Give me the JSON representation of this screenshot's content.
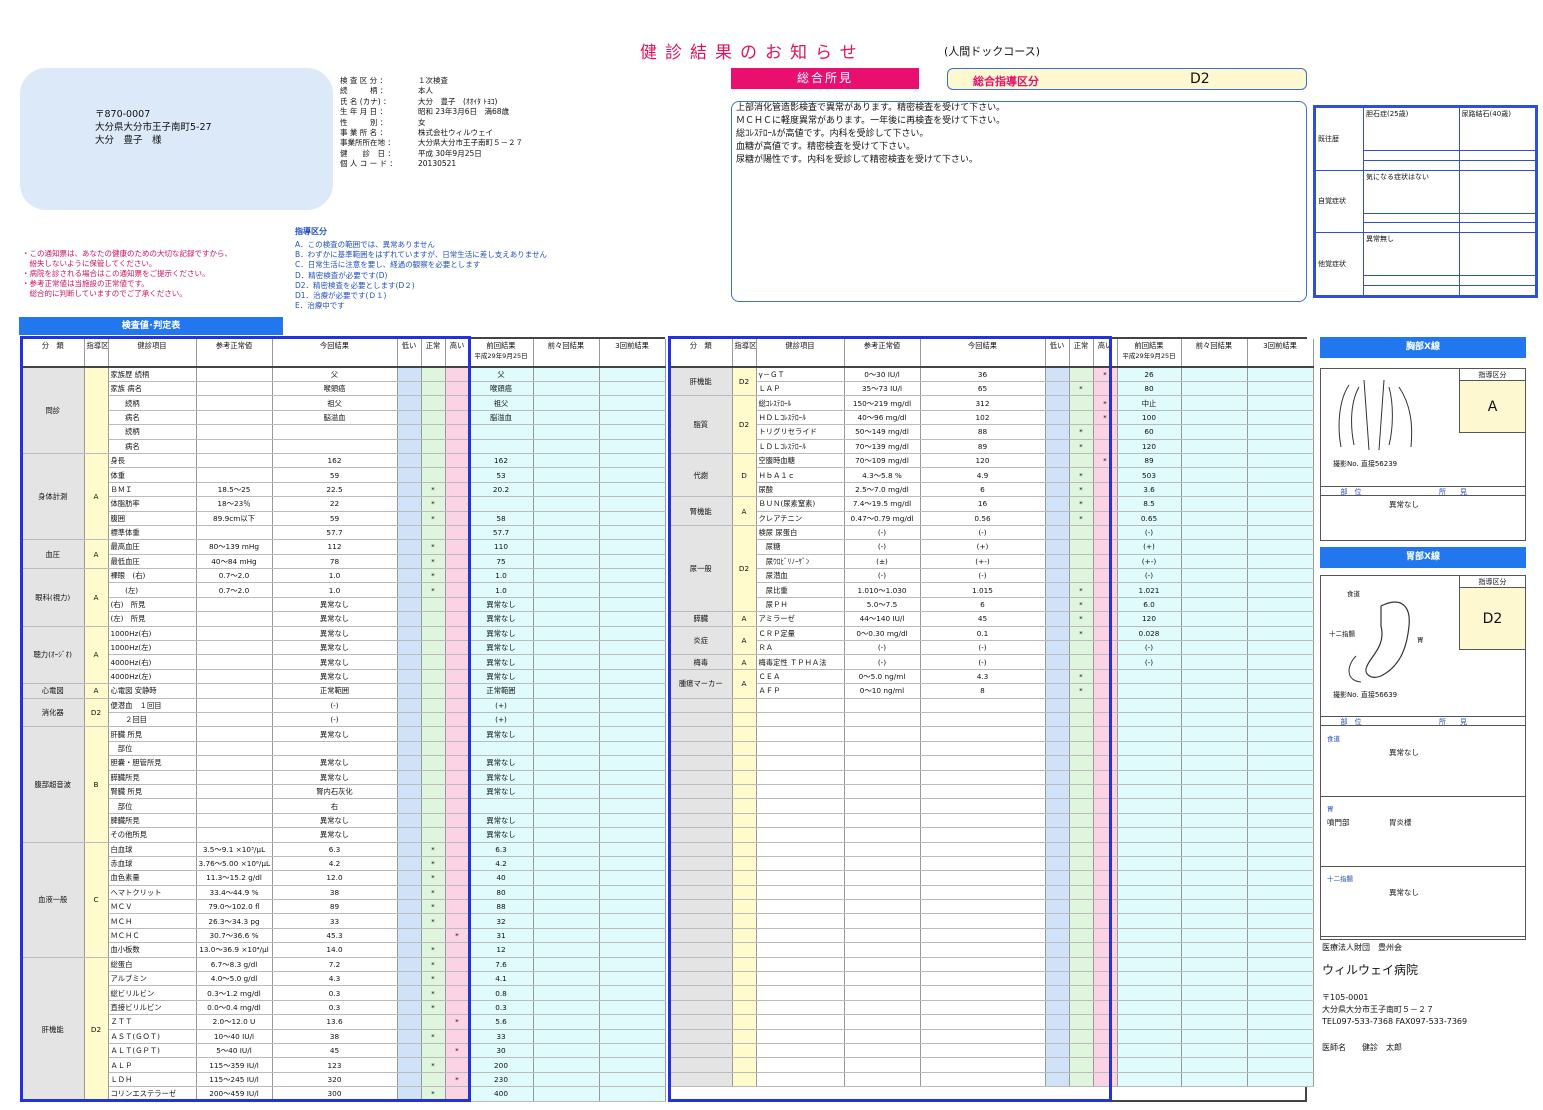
{
  "header": {
    "title": "健診結果のお知らせ",
    "subtitle": "(人間ドックコース)"
  },
  "address": {
    "zip": "〒870-0007",
    "line": "大分県大分市王子南町5-27",
    "name": "大分　豊子　様"
  },
  "patient": [
    {
      "k": "検 査 区 分 ：",
      "v": "１次検査"
    },
    {
      "k": "続　　　柄 ：",
      "v": "本人"
    },
    {
      "k": "氏 名 (カナ) ：",
      "v": "大分　豊子　(ｵｵｲﾀ ﾄﾖｺ)"
    },
    {
      "k": "生 年 月 日 ：",
      "v": "昭和 23年3月6日　満68歳"
    },
    {
      "k": "性　　　別 ：",
      "v": "女"
    },
    {
      "k": "事 業 所 名 ：",
      "v": "株式会社ウィルウェイ"
    },
    {
      "k": "事業所所在地 ：",
      "v": "大分県大分市王子南町５－２７"
    },
    {
      "k": "健　　診　日 ：",
      "v": "平成 30年9月25日"
    },
    {
      "k": "個 人 コ ー ド ：",
      "v": "20130521"
    }
  ],
  "notes": [
    "・この通知票は、あなたの健康のための大切な記録ですから、",
    "　紛失しないように保管してください。",
    "・病院を診される場合はこの通知票をご提示ください。",
    "・参考正常値は当施設の正常値です。",
    "　総合的に判断していますのでご了承ください。"
  ],
  "guide": {
    "title": "指導区分",
    "items": [
      "A．この検査の範囲では、異常ありません",
      "B．わずかに基準範囲をはずれていますが、日常生活に差し支えありません",
      "C．日常生活に注意を要し、経過の観察を必要とします",
      "D．精密検査が必要です(D)",
      "D2．精密検査を必要とします(D２)",
      "D1．治療が必要です(Ｄ１)",
      "E．治療中です"
    ]
  },
  "summary": {
    "label": "総合所見",
    "guide_label": "総合指導区分",
    "guide_value": "D2",
    "findings": [
      "上部消化管造影検査で異常があります。精密検査を受けて下さい。",
      "ＭＣＨＣに軽度異常があります。一年後に再検査を受けて下さい。",
      "総ｺﾚｽﾃﾛｰﾙが高値です。内科を受診して下さい。",
      "血糖が高値です。精密検査を受けて下さい。",
      "尿糖が陽性です。内科を受診して精密検査を受けて下さい。"
    ]
  },
  "history": [
    {
      "label": "既往歴",
      "rows": [
        [
          "胆石症(25歳)",
          "尿路結石(40歳)"
        ],
        [
          "",
          ""
        ],
        [
          "",
          ""
        ]
      ]
    },
    {
      "label": "自覚症状",
      "rows": [
        [
          "気になる症状はない",
          ""
        ],
        [
          "",
          ""
        ],
        [
          "",
          ""
        ]
      ]
    },
    {
      "label": "他覚症状",
      "rows": [
        [
          "異常無し",
          ""
        ],
        [
          "",
          ""
        ],
        [
          "",
          ""
        ]
      ]
    }
  ],
  "section_title": "検査値･判定表",
  "table_headers": [
    "分　類",
    "指導区分",
    "健診項目",
    "参考正常値",
    "今回結果",
    "低い",
    "正常",
    "高い",
    "前回結果",
    "前々回結果",
    "3回前結果"
  ],
  "prev_date": "平成29年9月25日",
  "left_rows": [
    [
      "問診",
      "",
      "家族歴 続柄",
      "",
      "父",
      "",
      "",
      "",
      "父",
      "",
      ""
    ],
    [
      "",
      "",
      "家族 病名",
      "",
      "喉頭癌",
      "",
      "",
      "",
      "喉頭癌",
      "",
      ""
    ],
    [
      "",
      "",
      "　　続柄",
      "",
      "祖父",
      "",
      "",
      "",
      "祖父",
      "",
      ""
    ],
    [
      "",
      "",
      "　　病名",
      "",
      "脳溢血",
      "",
      "",
      "",
      "脳溢血",
      "",
      ""
    ],
    [
      "",
      "",
      "　　続柄",
      "",
      "",
      "",
      "",
      "",
      "",
      "",
      ""
    ],
    [
      "",
      "",
      "　　病名",
      "",
      "",
      "",
      "",
      "",
      "",
      "",
      ""
    ],
    [
      "身体計測",
      "A",
      "身長",
      "",
      "162",
      "",
      "",
      "",
      "162",
      "",
      ""
    ],
    [
      "",
      "",
      "体重",
      "",
      "59",
      "",
      "",
      "",
      "53",
      "",
      ""
    ],
    [
      "",
      "",
      "ＢＭＩ",
      "18.5～25",
      "22.5",
      "",
      "*",
      "",
      "20.2",
      "",
      ""
    ],
    [
      "",
      "",
      "体脂肪率",
      "18～23％",
      "22",
      "",
      "*",
      "",
      "",
      "",
      ""
    ],
    [
      "",
      "",
      "腹囲",
      "89.9cm以下",
      "59",
      "",
      "*",
      "",
      "58",
      "",
      ""
    ],
    [
      "",
      "",
      "標準体重",
      "",
      "57.7",
      "",
      "",
      "",
      "57.7",
      "",
      ""
    ],
    [
      "血圧",
      "A",
      "最高血圧",
      "80～139 mHg",
      "112",
      "",
      "*",
      "",
      "110",
      "",
      ""
    ],
    [
      "",
      "",
      "最低血圧",
      "40～84 mHg",
      "78",
      "",
      "*",
      "",
      "75",
      "",
      ""
    ],
    [
      "眼科(視力)",
      "A",
      "裸眼　(右)",
      "0.7～2.0",
      "1.0",
      "",
      "*",
      "",
      "1.0",
      "",
      ""
    ],
    [
      "",
      "",
      "　　(左)",
      "0.7～2.0",
      "1.0",
      "",
      "*",
      "",
      "1.0",
      "",
      ""
    ],
    [
      "",
      "",
      "(右)　所見",
      "",
      "異常なし",
      "",
      "",
      "",
      "異常なし",
      "",
      ""
    ],
    [
      "",
      "",
      "(左)　所見",
      "",
      "異常なし",
      "",
      "",
      "",
      "異常なし",
      "",
      ""
    ],
    [
      "聴力(ｵｰｼﾞｵ)",
      "A",
      "1000Hz(右)",
      "",
      "異常なし",
      "",
      "",
      "",
      "異常なし",
      "",
      ""
    ],
    [
      "",
      "",
      "1000Hz(左)",
      "",
      "異常なし",
      "",
      "",
      "",
      "異常なし",
      "",
      ""
    ],
    [
      "",
      "",
      "4000Hz(右)",
      "",
      "異常なし",
      "",
      "",
      "",
      "異常なし",
      "",
      ""
    ],
    [
      "",
      "",
      "4000Hz(左)",
      "",
      "異常なし",
      "",
      "",
      "",
      "異常なし",
      "",
      ""
    ],
    [
      "心電図",
      "A",
      "心電図 安静時",
      "",
      "正常範囲",
      "",
      "",
      "",
      "正常範囲",
      "",
      ""
    ],
    [
      "消化器",
      "D2",
      "便潜血　１回目",
      "",
      "(-)",
      "",
      "",
      "",
      "(+)",
      "",
      ""
    ],
    [
      "",
      "",
      "　　２回目",
      "",
      "(-)",
      "",
      "",
      "",
      "(+)",
      "",
      ""
    ],
    [
      "腹部超音波",
      "B",
      "肝臓 所見",
      "",
      "異常なし",
      "",
      "",
      "",
      "異常なし",
      "",
      ""
    ],
    [
      "",
      "",
      "　部位",
      "",
      "",
      "",
      "",
      "",
      "",
      "",
      ""
    ],
    [
      "",
      "",
      "胆嚢・胆管所見",
      "",
      "異常なし",
      "",
      "",
      "",
      "異常なし",
      "",
      ""
    ],
    [
      "",
      "",
      "膵臓所見",
      "",
      "異常なし",
      "",
      "",
      "",
      "異常なし",
      "",
      ""
    ],
    [
      "",
      "",
      "腎臓 所見",
      "",
      "腎内石灰化",
      "",
      "",
      "",
      "異常なし",
      "",
      ""
    ],
    [
      "",
      "",
      "　部位",
      "",
      "右",
      "",
      "",
      "",
      "",
      "",
      ""
    ],
    [
      "",
      "",
      "脾臓所見",
      "",
      "異常なし",
      "",
      "",
      "",
      "異常なし",
      "",
      ""
    ],
    [
      "",
      "",
      "その他所見",
      "",
      "異常なし",
      "",
      "",
      "",
      "異常なし",
      "",
      ""
    ],
    [
      "血液一般",
      "C",
      "白血球",
      "3.5～9.1 ×10³/μL",
      "6.3",
      "",
      "*",
      "",
      "6.3",
      "",
      ""
    ],
    [
      "",
      "",
      "赤血球",
      "3.76～5.00 ×10⁶/μL",
      "4.2",
      "",
      "*",
      "",
      "4.2",
      "",
      ""
    ],
    [
      "",
      "",
      "血色素量",
      "11.3～15.2 g/dl",
      "12.0",
      "",
      "*",
      "",
      "40",
      "",
      ""
    ],
    [
      "",
      "",
      "ヘマトクリット",
      "33.4～44.9 %",
      "38",
      "",
      "*",
      "",
      "80",
      "",
      ""
    ],
    [
      "",
      "",
      "ＭＣＶ",
      "79.0～102.0 fl",
      "89",
      "",
      "*",
      "",
      "88",
      "",
      ""
    ],
    [
      "",
      "",
      "ＭＣＨ",
      "26.3～34.3 pg",
      "33",
      "",
      "*",
      "",
      "32",
      "",
      ""
    ],
    [
      "",
      "",
      "ＭＣＨＣ",
      "30.7～36.6 %",
      "45.3",
      "",
      "",
      "*",
      "31",
      "",
      ""
    ],
    [
      "",
      "",
      "血小板数",
      "13.0～36.9 ×10⁴/μl",
      "14.0",
      "",
      "*",
      "",
      "12",
      "",
      ""
    ],
    [
      "肝機能",
      "D2",
      "総蛋白",
      "6.7～8.3 g/dl",
      "7.2",
      "",
      "*",
      "",
      "7.6",
      "",
      ""
    ],
    [
      "",
      "",
      "アルブミン",
      "4.0～5.0 g/dl",
      "4.3",
      "",
      "*",
      "",
      "4.1",
      "",
      ""
    ],
    [
      "",
      "",
      "総ビリルビン",
      "0.3～1.2 mg/dl",
      "0.3",
      "",
      "*",
      "",
      "0.8",
      "",
      ""
    ],
    [
      "",
      "",
      "直接ビリルビン",
      "0.0～0.4 mg/dl",
      "0.3",
      "",
      "*",
      "",
      "0.3",
      "",
      ""
    ],
    [
      "",
      "",
      "ＺＴＴ",
      "2.0～12.0 U",
      "13.6",
      "",
      "",
      "*",
      "5.6",
      "",
      ""
    ],
    [
      "",
      "",
      "ＡＳＴ(ＧＯＴ)",
      "10～40 IU/l",
      "38",
      "",
      "*",
      "",
      "33",
      "",
      ""
    ],
    [
      "",
      "",
      "ＡＬＴ(ＧＰＴ)",
      "5～40 IU/l",
      "45",
      "",
      "",
      "*",
      "30",
      "",
      ""
    ],
    [
      "",
      "",
      "ＡＬＰ",
      "115～359 IU/l",
      "123",
      "",
      "*",
      "",
      "200",
      "",
      ""
    ],
    [
      "",
      "",
      "ＬＤＨ",
      "115～245 IU/l",
      "320",
      "",
      "",
      "*",
      "230",
      "",
      ""
    ],
    [
      "",
      "",
      "コリンエステラーゼ",
      "200～459 IU/l",
      "300",
      "",
      "*",
      "",
      "400",
      "",
      ""
    ]
  ],
  "right_rows": [
    [
      "肝機能",
      "D2",
      "γ－ＧＴ",
      "0～30 IU/l",
      "36",
      "",
      "",
      "*",
      "26",
      "",
      ""
    ],
    [
      "",
      "",
      "ＬＡＰ",
      "35～73 IU/l",
      "65",
      "",
      "*",
      "",
      "80",
      "",
      ""
    ],
    [
      "脂質",
      "D2",
      "総ｺﾚｽﾃﾛｰﾙ",
      "150～219 mg/dl",
      "312",
      "",
      "",
      "*",
      "中止",
      "",
      ""
    ],
    [
      "",
      "",
      "ＨＤＬｺﾚｽﾃﾛｰﾙ",
      "40～96 mg/dl",
      "102",
      "",
      "",
      "*",
      "100",
      "",
      ""
    ],
    [
      "",
      "",
      "トリグリセライド",
      "50～149 mg/dl",
      "88",
      "",
      "*",
      "",
      "60",
      "",
      ""
    ],
    [
      "",
      "",
      "ＬＤＬｺﾚｽﾃﾛｰﾙ",
      "70～139 mg/dl",
      "89",
      "",
      "*",
      "",
      "120",
      "",
      ""
    ],
    [
      "代謝",
      "D",
      "空腹時血糖",
      "70～109 mg/dl",
      "120",
      "",
      "",
      "*",
      "89",
      "",
      ""
    ],
    [
      "",
      "",
      "ＨｂＡ１ｃ",
      "4.3～5.8 %",
      "4.9",
      "",
      "*",
      "",
      "503",
      "",
      ""
    ],
    [
      "",
      "",
      "尿酸",
      "2.5～7.0 mg/dl",
      "6",
      "",
      "*",
      "",
      "3.6",
      "",
      ""
    ],
    [
      "腎機能",
      "A",
      "ＢＵＮ(尿素窒素)",
      "7.4～19.5 mg/dl",
      "16",
      "",
      "*",
      "",
      "8.5",
      "",
      ""
    ],
    [
      "",
      "",
      "クレアチニン",
      "0.47～0.79 mg/dl",
      "0.56",
      "",
      "*",
      "",
      "0.65",
      "",
      ""
    ],
    [
      "尿一般",
      "D2",
      "検尿 尿蛋白",
      "(-)",
      "(-)",
      "",
      "",
      "",
      "(-)",
      "",
      ""
    ],
    [
      "",
      "",
      "　尿糖",
      "(-)",
      "(+)",
      "",
      "",
      "",
      "(+)",
      "",
      ""
    ],
    [
      "",
      "",
      "　尿ｳﾛﾋﾞﾘﾉｰｹﾞﾝ",
      "(±)",
      "(+-)",
      "",
      "",
      "",
      "(+-)",
      "",
      ""
    ],
    [
      "",
      "",
      "　尿潜血",
      "(-)",
      "(-)",
      "",
      "",
      "",
      "(-)",
      "",
      ""
    ],
    [
      "",
      "",
      "　尿比重",
      "1.010～1.030",
      "1.015",
      "",
      "*",
      "",
      "1.021",
      "",
      ""
    ],
    [
      "",
      "",
      "　尿ＰＨ",
      "5.0～7.5",
      "6",
      "",
      "*",
      "",
      "6.0",
      "",
      ""
    ],
    [
      "膵臓",
      "A",
      "アミラーゼ",
      "44～140 IU/l",
      "45",
      "",
      "*",
      "",
      "120",
      "",
      ""
    ],
    [
      "炎症",
      "A",
      "ＣＲＰ定量",
      "0～0.30 mg/dl",
      "0.1",
      "",
      "*",
      "",
      "0.028",
      "",
      ""
    ],
    [
      "",
      "",
      "ＲＡ",
      "(-)",
      "(-)",
      "",
      "",
      "",
      "(-)",
      "",
      ""
    ],
    [
      "梅毒",
      "A",
      "梅毒定性 ＴＰＨＡ法",
      "(-)",
      "(-)",
      "",
      "",
      "",
      "(-)",
      "",
      ""
    ],
    [
      "腫瘍マーカー",
      "A",
      "ＣＥＡ",
      "0～5.0 ng/ml",
      "4.3",
      "",
      "*",
      "",
      "",
      "",
      ""
    ],
    [
      "",
      "",
      "ＡＦＰ",
      "0～10 ng/ml",
      "8",
      "",
      "*",
      "",
      "",
      "",
      ""
    ],
    [
      "",
      "",
      "",
      "",
      "",
      "",
      "",
      "",
      "",
      "",
      ""
    ],
    [
      "",
      "",
      "",
      "",
      "",
      "",
      "",
      "",
      "",
      "",
      ""
    ],
    [
      "",
      "",
      "",
      "",
      "",
      "",
      "",
      "",
      "",
      "",
      ""
    ],
    [
      "",
      "",
      "",
      "",
      "",
      "",
      "",
      "",
      "",
      "",
      ""
    ],
    [
      "",
      "",
      "",
      "",
      "",
      "",
      "",
      "",
      "",
      "",
      ""
    ],
    [
      "",
      "",
      "",
      "",
      "",
      "",
      "",
      "",
      "",
      "",
      ""
    ],
    [
      "",
      "",
      "",
      "",
      "",
      "",
      "",
      "",
      "",
      "",
      ""
    ],
    [
      "",
      "",
      "",
      "",
      "",
      "",
      "",
      "",
      "",
      "",
      ""
    ],
    [
      "",
      "",
      "",
      "",
      "",
      "",
      "",
      "",
      "",
      "",
      ""
    ],
    [
      "",
      "",
      "",
      "",
      "",
      "",
      "",
      "",
      "",
      "",
      ""
    ],
    [
      "",
      "",
      "",
      "",
      "",
      "",
      "",
      "",
      "",
      "",
      ""
    ],
    [
      "",
      "",
      "",
      "",
      "",
      "",
      "",
      "",
      "",
      "",
      ""
    ],
    [
      "",
      "",
      "",
      "",
      "",
      "",
      "",
      "",
      "",
      "",
      ""
    ],
    [
      "",
      "",
      "",
      "",
      "",
      "",
      "",
      "",
      "",
      "",
      ""
    ],
    [
      "",
      "",
      "",
      "",
      "",
      "",
      "",
      "",
      "",
      "",
      ""
    ],
    [
      "",
      "",
      "",
      "",
      "",
      "",
      "",
      "",
      "",
      "",
      ""
    ],
    [
      "",
      "",
      "",
      "",
      "",
      "",
      "",
      "",
      "",
      "",
      ""
    ],
    [
      "",
      "",
      "",
      "",
      "",
      "",
      "",
      "",
      "",
      "",
      ""
    ],
    [
      "",
      "",
      "",
      "",
      "",
      "",
      "",
      "",
      "",
      "",
      ""
    ],
    [
      "",
      "",
      "",
      "",
      "",
      "",
      "",
      "",
      "",
      "",
      ""
    ],
    [
      "",
      "",
      "",
      "",
      "",
      "",
      "",
      "",
      "",
      "",
      ""
    ],
    [
      "",
      "",
      "",
      "",
      "",
      "",
      "",
      "",
      "",
      "",
      ""
    ],
    [
      "",
      "",
      "",
      "",
      "",
      "",
      "",
      "",
      "",
      "",
      ""
    ],
    [
      "",
      "",
      "",
      "",
      "",
      "",
      "",
      "",
      "",
      "",
      ""
    ],
    [
      "",
      "",
      "",
      "",
      "",
      "",
      "",
      "",
      "",
      "",
      ""
    ],
    [
      "",
      "",
      "",
      "",
      "",
      "",
      "",
      "",
      "",
      "",
      ""
    ],
    [
      "",
      "",
      "",
      "",
      "",
      "",
      "",
      "",
      "",
      "",
      ""
    ]
  ],
  "chest": {
    "title": "胸部X線",
    "guide_label": "指導区分",
    "guide_value": "A",
    "film": "撮影No. 直接56239",
    "find_cols": [
      "部　位",
      "所　　見"
    ],
    "finding": "異常なし"
  },
  "stomach": {
    "title": "胃部X線",
    "guide_label": "指導区分",
    "guide_value": "D2",
    "film": "撮影No. 直接56639",
    "find_cols": [
      "部　位",
      "所　　見"
    ],
    "labels": [
      "食道",
      "十二指腸",
      "胃"
    ],
    "findings": [
      {
        "part": "食道",
        "text": "異常なし"
      },
      {
        "part": "胃",
        "sub": "噴門部",
        "text": "胃炎様"
      },
      {
        "part": "十二指腸",
        "text": "異常なし"
      }
    ]
  },
  "hospital": {
    "corp": "医療法人財団　豊州会",
    "name": "ウィルウェイ病院",
    "zip": "〒105-0001",
    "addr": "大分県大分市王子南町５－２７",
    "tel": "TEL097-533-7368 FAX097-533-7369",
    "doctor": "医師名　　健診　太郎"
  }
}
